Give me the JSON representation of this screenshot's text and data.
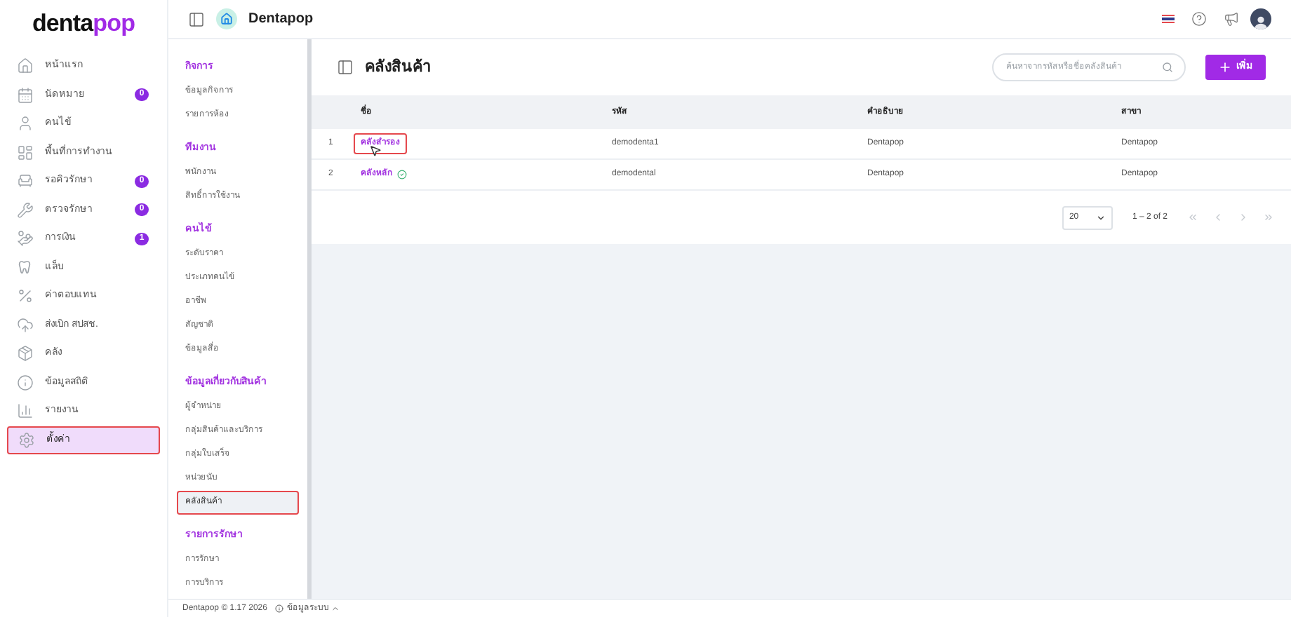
{
  "brand": {
    "logo_dark": "denta",
    "logo_accent": "pop"
  },
  "sidebar": {
    "items": [
      {
        "label": "หน้าแรก",
        "selected": false
      },
      {
        "label": "นัดหมาย",
        "badge": "0",
        "selected": false
      },
      {
        "label": "คนไข้",
        "selected": false
      },
      {
        "label": "พื้นที่การทำงาน",
        "selected": false
      },
      {
        "label": "รอคิวรักษา",
        "badge": "0",
        "selected": false
      },
      {
        "label": "ตรวจรักษา",
        "badge": "0",
        "selected": false
      },
      {
        "label": "การเงิน",
        "badge": "1",
        "selected": false
      },
      {
        "label": "แล็บ",
        "selected": false
      },
      {
        "label": "ค่าตอบแทน",
        "selected": false
      },
      {
        "label": "ส่งเบิก สปสช.",
        "selected": false
      },
      {
        "label": "คลัง",
        "selected": false
      },
      {
        "label": "ข้อมูลสถิติ",
        "selected": false
      },
      {
        "label": "รายงาน",
        "selected": false
      },
      {
        "label": "ตั้งค่า",
        "selected": true
      }
    ]
  },
  "topbar": {
    "clinic": "Dentapop"
  },
  "settings_menu": {
    "sections": [
      {
        "title": "กิจการ",
        "items": [
          {
            "label": "ข้อมูลกิจการ",
            "selected": false
          },
          {
            "label": "รายการห้อง",
            "selected": false
          }
        ]
      },
      {
        "title": "ทีมงาน",
        "items": [
          {
            "label": "พนักงาน",
            "selected": false
          },
          {
            "label": "สิทธิ์การใช้งาน",
            "selected": false
          }
        ]
      },
      {
        "title": "คนไข้",
        "items": [
          {
            "label": "ระดับราคา",
            "selected": false
          },
          {
            "label": "ประเภทคนไข้",
            "selected": false
          },
          {
            "label": "อาชีพ",
            "selected": false
          },
          {
            "label": "สัญชาติ",
            "selected": false
          },
          {
            "label": "ข้อมูลสื่อ",
            "selected": false
          }
        ]
      },
      {
        "title": "ข้อมูลเกี่ยวกับสินค้า",
        "items": [
          {
            "label": "ผู้จำหน่าย",
            "selected": false
          },
          {
            "label": "กลุ่มสินค้าและบริการ",
            "selected": false
          },
          {
            "label": "กลุ่มใบเสร็จ",
            "selected": false
          },
          {
            "label": "หน่วยนับ",
            "selected": false
          },
          {
            "label": "คลังสินค้า",
            "selected": true
          }
        ]
      },
      {
        "title": "รายการรักษา",
        "items": [
          {
            "label": "การรักษา",
            "selected": false
          },
          {
            "label": "การบริการ",
            "selected": false
          }
        ]
      }
    ]
  },
  "page": {
    "title": "คลังสินค้า",
    "search": {
      "placeholder": "ค้นหาจากรหัสหรือชื่อคลังสินค้า"
    },
    "add_button": "เพิ่ม"
  },
  "table": {
    "columns": [
      "ชื่อ",
      "รหัส",
      "คำอธิบาย",
      "สาขา"
    ],
    "rows": [
      {
        "index": "1",
        "name": "คลังสำรอง",
        "code": "demodenta1",
        "description": "Dentapop",
        "branch": "Dentapop",
        "default": false,
        "highlighted": true
      },
      {
        "index": "2",
        "name": "คลังหลัก",
        "code": "demodental",
        "description": "Dentapop",
        "branch": "Dentapop",
        "default": true,
        "highlighted": false
      }
    ]
  },
  "pagination": {
    "page_size": "20",
    "range": "1 – 2 of 2"
  },
  "footer": {
    "version": "Dentapop © 1.17 2026",
    "system_info": "ข้อมูลระบบ"
  }
}
